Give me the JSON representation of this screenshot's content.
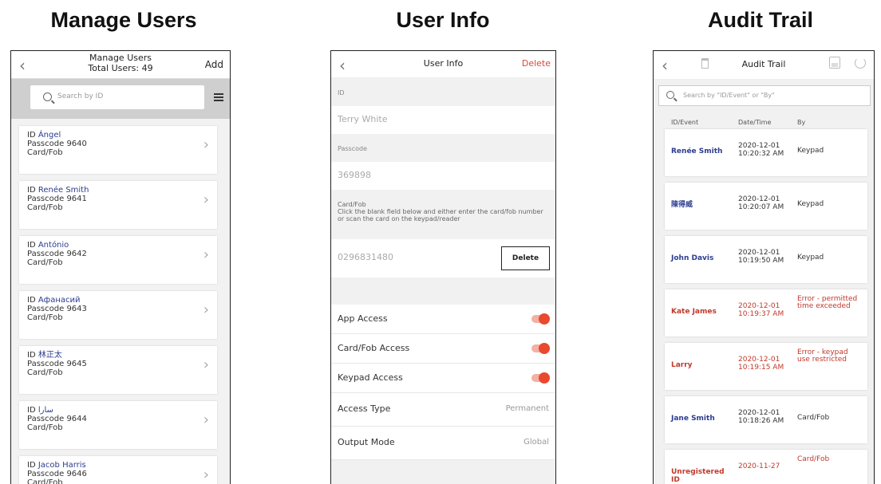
{
  "titles": {
    "manage_users": "Manage Users",
    "user_info": "User Info",
    "audit_trail": "Audit Trail"
  },
  "manage_users": {
    "nav_title": "Manage Users",
    "nav_subtitle": "Total Users: 49",
    "add_label": "Add",
    "search_placeholder": "Search by ID",
    "id_prefix": "ID",
    "passcode_prefix": "Passcode",
    "card_label": "Card/Fob",
    "users": [
      {
        "name": "Ángel",
        "passcode": "9640"
      },
      {
        "name": "Renée Smith",
        "passcode": "9641"
      },
      {
        "name": "António",
        "passcode": "9642"
      },
      {
        "name": "Афанасий",
        "passcode": "9643"
      },
      {
        "name": "林正太",
        "passcode": "9645"
      },
      {
        "name": "سارا",
        "passcode": "9644"
      },
      {
        "name": "Jacob Harris",
        "passcode": "9646"
      }
    ]
  },
  "user_info": {
    "nav_title": "User Info",
    "delete_label": "Delete",
    "id_label": "ID",
    "id_value": "Terry White",
    "passcode_label": "Passcode",
    "passcode_value": "369898",
    "card_label": "Card/Fob",
    "card_hint": "Click the blank field below and either enter the card/fob number or scan the card on the keypad/reader",
    "card_value": "0296831480",
    "card_delete": "Delete",
    "toggles": [
      {
        "label": "App Access",
        "on": true
      },
      {
        "label": "Card/Fob Access",
        "on": true
      },
      {
        "label": "Keypad Access",
        "on": true
      }
    ],
    "access_type_label": "Access Type",
    "access_type_value": "Permanent",
    "output_mode_label": "Output Mode",
    "output_mode_value": "Global",
    "toggle_color": "#e8492f"
  },
  "audit_trail": {
    "nav_title": "Audit Trail",
    "search_placeholder": "Search by \"ID/Event\" or \"By\"",
    "col_id": "ID/Event",
    "col_time": "Date/Time",
    "col_by": "By",
    "error_color": "#c0392b",
    "rows": [
      {
        "id": "Renée Smith",
        "date": "2020-12-01",
        "time": "10:20:32 AM",
        "by": "Keypad",
        "error": false
      },
      {
        "id": "陳得威",
        "date": "2020-12-01",
        "time": "10:20:07 AM",
        "by": "Keypad",
        "error": false
      },
      {
        "id": "John Davis",
        "date": "2020-12-01",
        "time": "10:19:50 AM",
        "by": "Keypad",
        "error": false
      },
      {
        "id": "Kate James",
        "date": "2020-12-01",
        "time": "10:19:37 AM",
        "by": "Error - permitted time exceeded",
        "error": true
      },
      {
        "id": "Larry",
        "date": "2020-12-01",
        "time": "10:19:15 AM",
        "by": "Error - keypad use restricted",
        "error": true
      },
      {
        "id": "Jane Smith",
        "date": "2020-12-01",
        "time": "10:18:26 AM",
        "by": "Card/Fob",
        "error": false
      },
      {
        "id": "Unregistered ID",
        "date": "2020-11-27",
        "time": "",
        "by": "Card/Fob",
        "error": true
      }
    ]
  }
}
